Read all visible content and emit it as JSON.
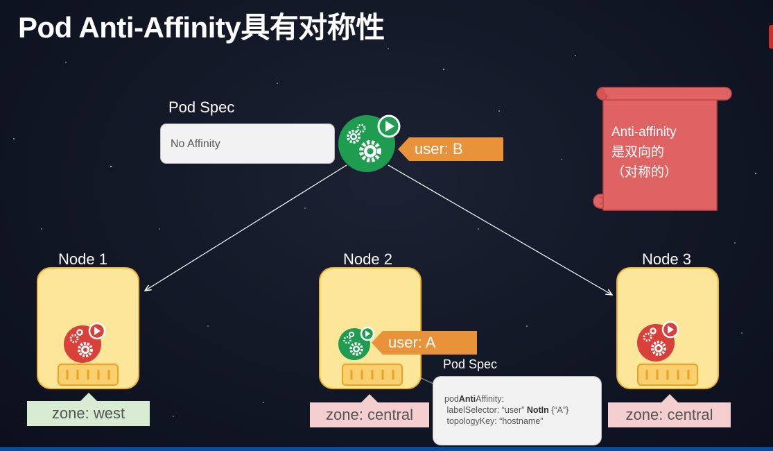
{
  "title": "Pod Anti-Affinity具有对称性",
  "top_pod": {
    "spec_label": "Pod Spec",
    "spec_text": "No Affinity",
    "tag": "user: B",
    "color": "#1e9c50"
  },
  "nodes": [
    {
      "label": "Node 1",
      "zone": "zone: west"
    },
    {
      "label": "Node 2",
      "zone": "zone: central"
    },
    {
      "label": "Node 3",
      "zone": "zone: central"
    }
  ],
  "node2_pod": {
    "tag": "user: A",
    "spec_label": "Pod Spec",
    "spec_line1_pre": "pod",
    "spec_line1_bold": "Anti",
    "spec_line1_post": "Affinity:",
    "spec_line2_pre": "labelSelector: “user” ",
    "spec_line2_bold": "NotIn",
    "spec_line2_post": " {“A”}",
    "spec_line3": "topologyKey: “hostname”",
    "color": "#1e9c50"
  },
  "existing_pod_color": "#d9403a",
  "scroll": {
    "line1": "Anti-affinity",
    "line2": "是双向的",
    "line3": "（对称的）",
    "color": "#e06363"
  },
  "colors": {
    "tag": "#e8923a",
    "node_fill": "#fbe699",
    "node_border": "#f0b030",
    "zone_west": "#d8ecd3",
    "zone_central": "#f5cfcf"
  }
}
